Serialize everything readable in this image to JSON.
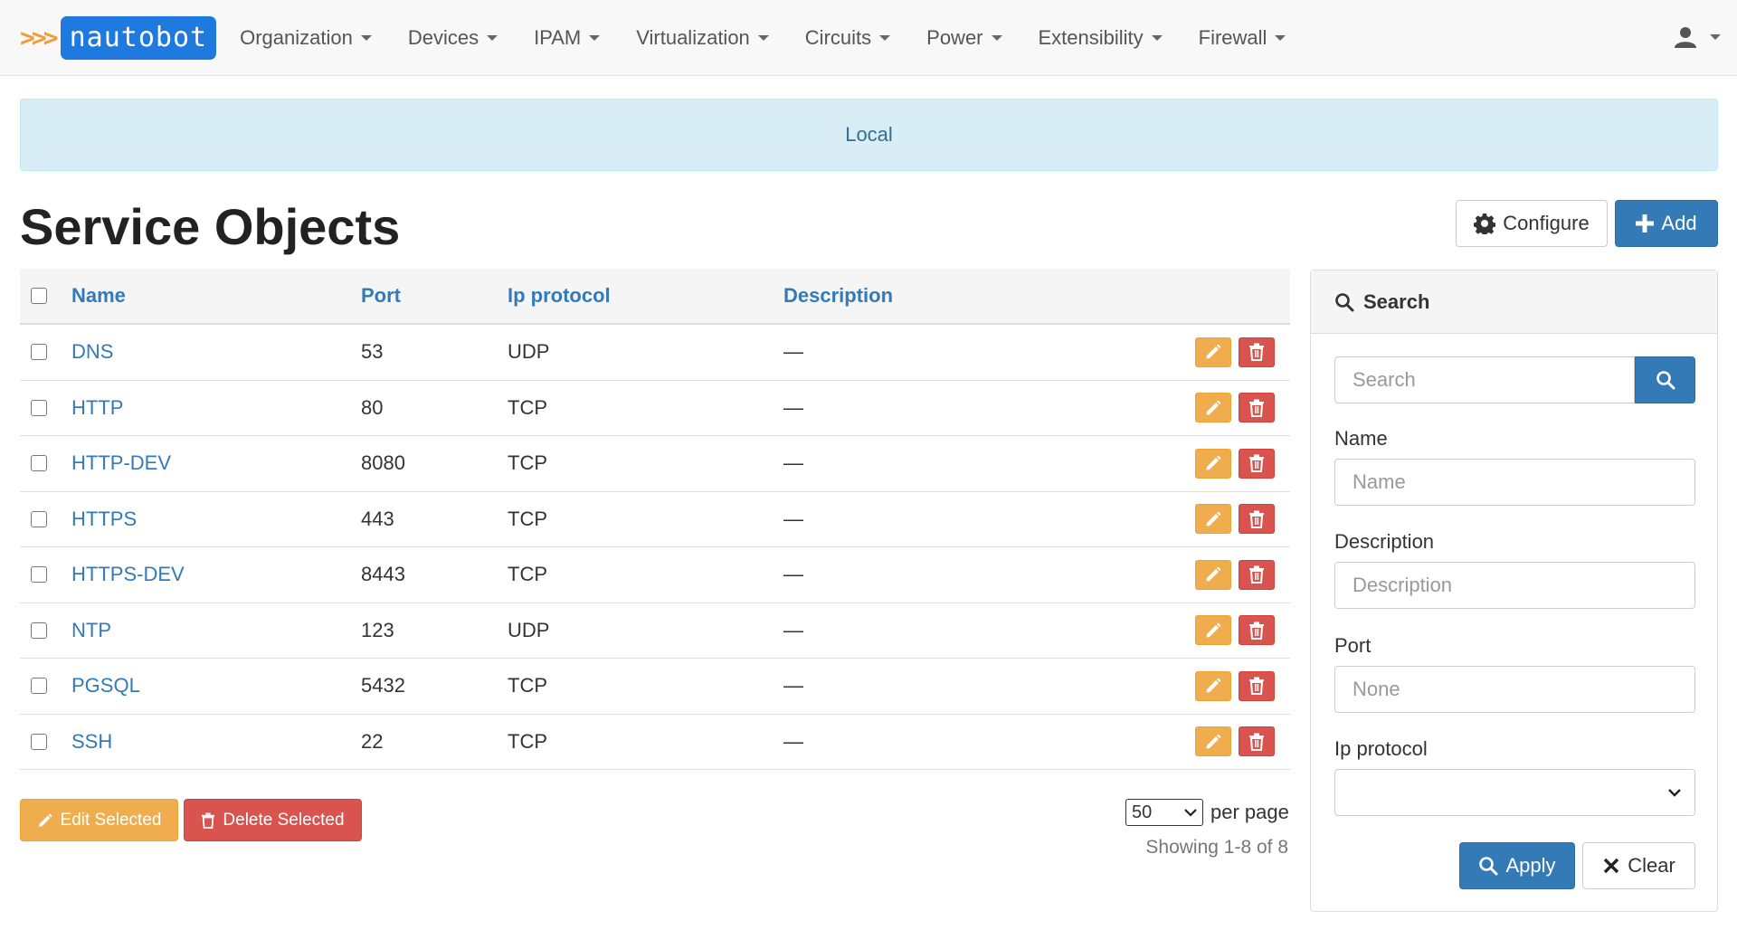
{
  "nav": {
    "brand_text": "nautobot",
    "brand_arrows": ">>>",
    "items": [
      {
        "label": "Organization"
      },
      {
        "label": "Devices"
      },
      {
        "label": "IPAM"
      },
      {
        "label": "Virtualization"
      },
      {
        "label": "Circuits"
      },
      {
        "label": "Power"
      },
      {
        "label": "Extensibility"
      },
      {
        "label": "Firewall"
      }
    ],
    "user_icon": "user-icon"
  },
  "banner": {
    "text": "Local"
  },
  "page": {
    "title": "Service Objects"
  },
  "toolbar": {
    "configure_label": "Configure",
    "add_label": "Add"
  },
  "table": {
    "headers": {
      "name": "Name",
      "port": "Port",
      "ip_protocol": "Ip protocol",
      "description": "Description"
    },
    "rows": [
      {
        "name": "DNS",
        "port": "53",
        "ip_protocol": "UDP",
        "description": "—"
      },
      {
        "name": "HTTP",
        "port": "80",
        "ip_protocol": "TCP",
        "description": "—"
      },
      {
        "name": "HTTP-DEV",
        "port": "8080",
        "ip_protocol": "TCP",
        "description": "—"
      },
      {
        "name": "HTTPS",
        "port": "443",
        "ip_protocol": "TCP",
        "description": "—"
      },
      {
        "name": "HTTPS-DEV",
        "port": "8443",
        "ip_protocol": "TCP",
        "description": "—"
      },
      {
        "name": "NTP",
        "port": "123",
        "ip_protocol": "UDP",
        "description": "—"
      },
      {
        "name": "PGSQL",
        "port": "5432",
        "ip_protocol": "TCP",
        "description": "—"
      },
      {
        "name": "SSH",
        "port": "22",
        "ip_protocol": "TCP",
        "description": "—"
      }
    ]
  },
  "bulk": {
    "edit_label": "Edit Selected",
    "delete_label": "Delete Selected"
  },
  "pagination": {
    "per_page_value": "50",
    "per_page_label": "per page",
    "showing": "Showing 1-8 of 8"
  },
  "search_panel": {
    "title": "Search",
    "search_placeholder": "Search",
    "fields": {
      "name_label": "Name",
      "name_placeholder": "Name",
      "description_label": "Description",
      "description_placeholder": "Description",
      "port_label": "Port",
      "port_placeholder": "None",
      "ip_protocol_label": "Ip protocol",
      "ip_protocol_value": ""
    },
    "apply_label": "Apply",
    "clear_label": "Clear"
  },
  "colors": {
    "primary": "#337ab7",
    "warning": "#f0ad4e",
    "danger": "#d9534f",
    "brand": "#1f7ae0",
    "info_bg": "#d9edf7"
  }
}
